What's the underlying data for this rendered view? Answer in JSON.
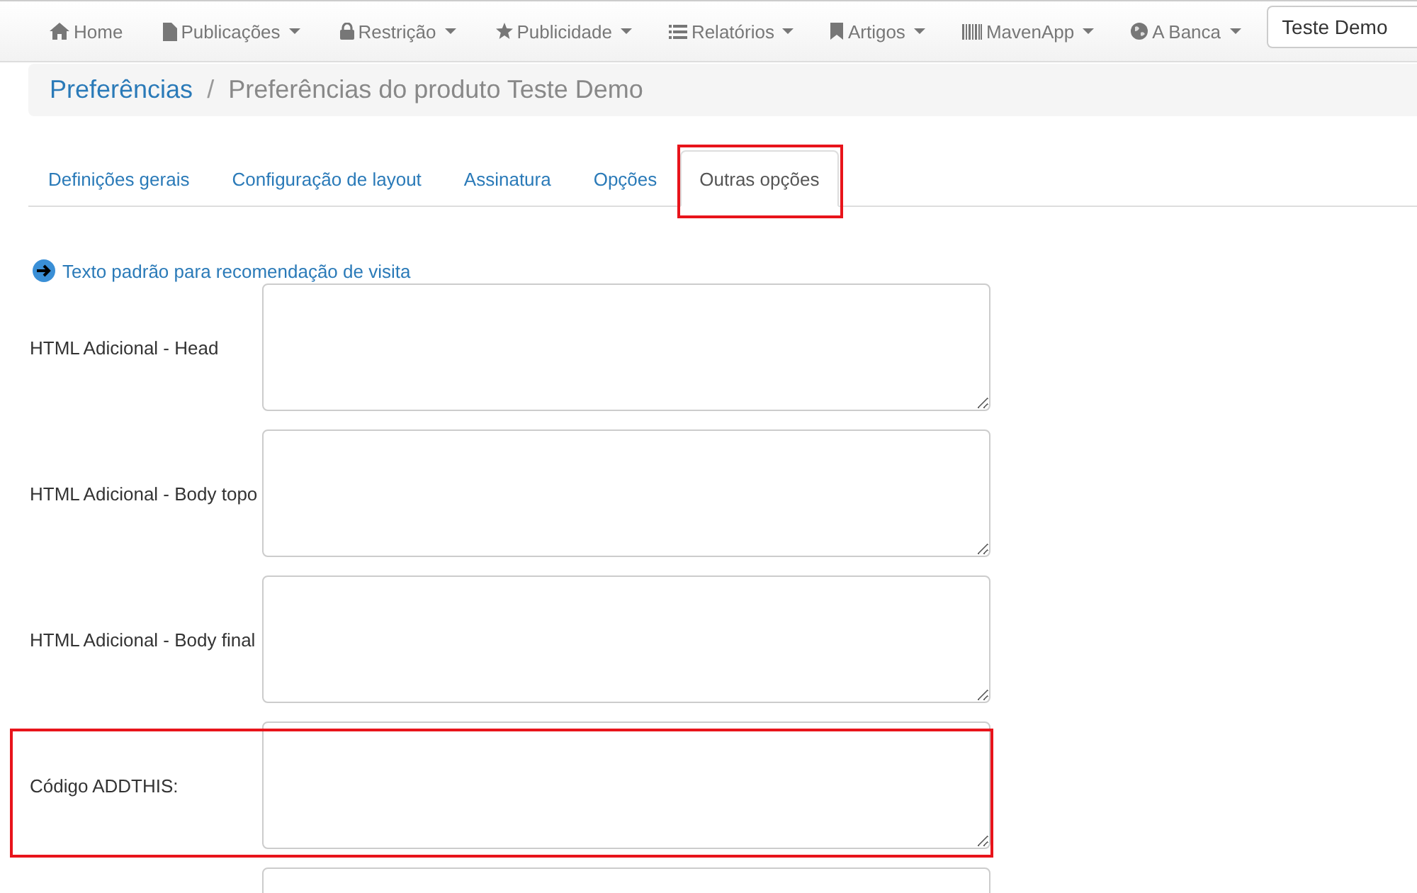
{
  "navbar": {
    "items": [
      {
        "label": "Home",
        "kind": "home",
        "dropdown": false
      },
      {
        "label": "Publicações",
        "kind": "file",
        "dropdown": true
      },
      {
        "label": "Restrição",
        "kind": "lock",
        "dropdown": true
      },
      {
        "label": "Publicidade",
        "kind": "star",
        "dropdown": true
      },
      {
        "label": "Relatórios",
        "kind": "list",
        "dropdown": true
      },
      {
        "label": "Artigos",
        "kind": "bookmark",
        "dropdown": true
      },
      {
        "label": "MavenApp",
        "kind": "barcode",
        "dropdown": true
      },
      {
        "label": "A Banca",
        "kind": "globe",
        "dropdown": true
      }
    ],
    "search_value": "Teste Demo"
  },
  "breadcrumb": {
    "separator": "/",
    "items": [
      {
        "label": "Preferências",
        "kind": "link"
      },
      {
        "label": "Preferências do produto Teste Demo",
        "kind": "current"
      }
    ]
  },
  "tabs": [
    {
      "label": "Definições gerais",
      "selected": false,
      "highlighted": false
    },
    {
      "label": "Configuração de layout",
      "selected": false,
      "highlighted": false
    },
    {
      "label": "Assinatura",
      "selected": false,
      "highlighted": false
    },
    {
      "label": "Opções",
      "selected": false,
      "highlighted": false
    },
    {
      "label": "Outras opções",
      "selected": true,
      "highlighted": true
    }
  ],
  "link": "Texto padrão para recomendação de visita",
  "fields": [
    {
      "label": "HTML Adicional - Head",
      "highlighted": false
    },
    {
      "label": "HTML Adicional - Body topo",
      "highlighted": false
    },
    {
      "label": "HTML Adicional - Body final",
      "highlighted": false
    },
    {
      "label": "Código ADDTHIS:",
      "highlighted": true
    },
    {
      "highlighted": false
    }
  ]
}
